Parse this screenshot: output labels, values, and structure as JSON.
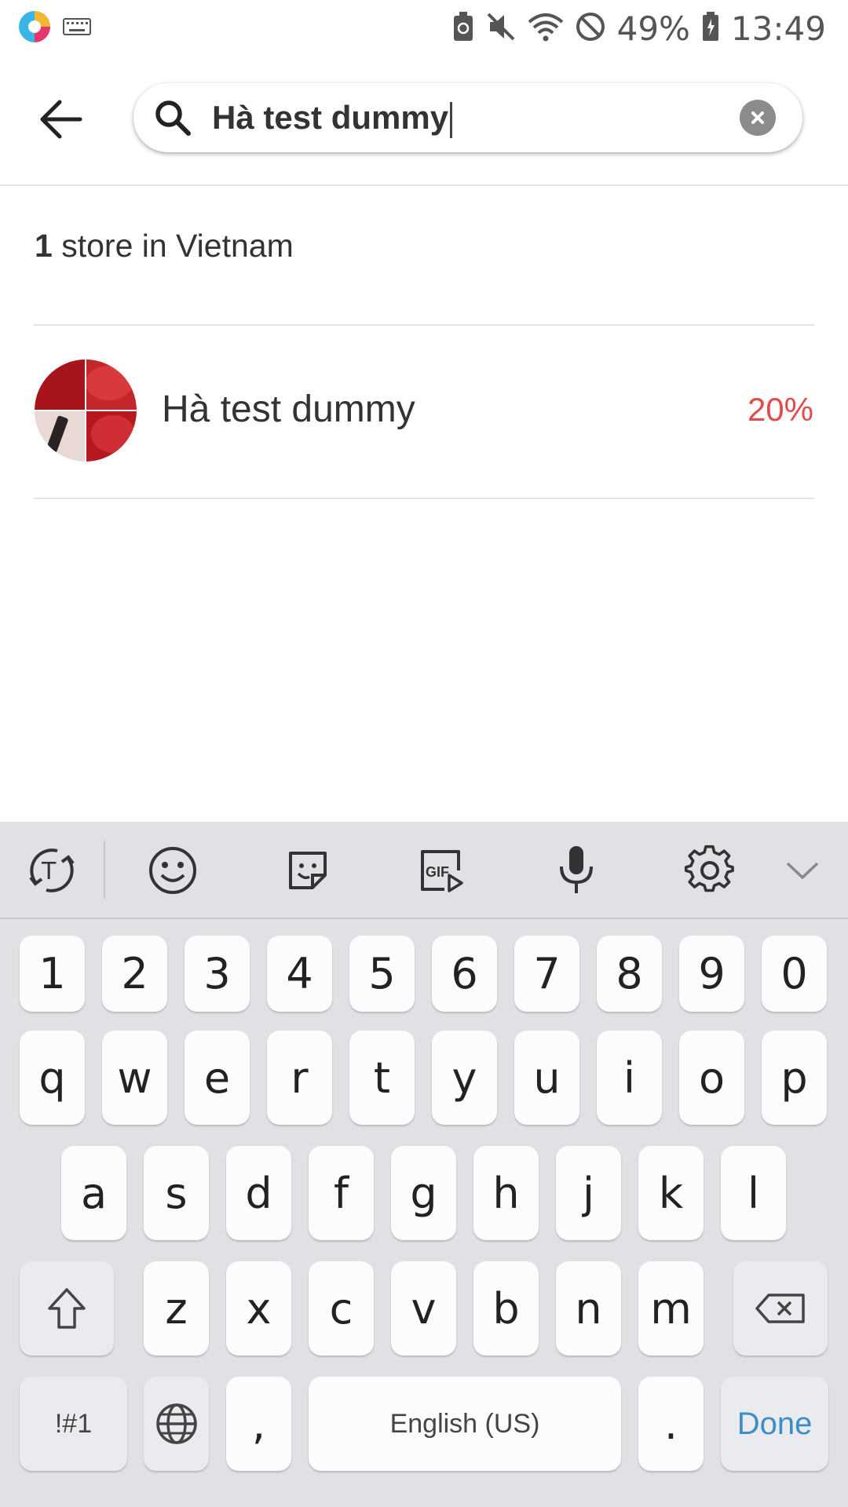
{
  "status_bar": {
    "battery_percent": "49%",
    "time": "13:49",
    "icons": [
      "app-logo-icon",
      "keyboard-icon",
      "battery-saver-icon",
      "mute-icon",
      "wifi-icon",
      "do-not-disturb-icon",
      "battery-icon"
    ]
  },
  "search": {
    "query": "Hà test dummy",
    "icons": [
      "back-arrow-icon",
      "search-icon",
      "clear-icon"
    ]
  },
  "results": {
    "count": "1",
    "label": "store in Vietnam",
    "stores": [
      {
        "name": "Hà test dummy",
        "discount": "20%",
        "avatar_icon": "store-avatar"
      }
    ]
  },
  "colors": {
    "discount": "#e34b4b",
    "done_key": "#3b8fc5",
    "keyboard_bg": "#dfe1e5"
  },
  "keyboard": {
    "toolbar": [
      "text-recognition-icon",
      "emoji-icon",
      "sticker-icon",
      "gif-icon",
      "microphone-icon",
      "settings-icon",
      "collapse-icon"
    ],
    "row_numbers": [
      "1",
      "2",
      "3",
      "4",
      "5",
      "6",
      "7",
      "8",
      "9",
      "0"
    ],
    "row_1": [
      "q",
      "w",
      "e",
      "r",
      "t",
      "y",
      "u",
      "i",
      "o",
      "p"
    ],
    "row_2": [
      "a",
      "s",
      "d",
      "f",
      "g",
      "h",
      "j",
      "k",
      "l"
    ],
    "row_3": [
      "z",
      "x",
      "c",
      "v",
      "b",
      "n",
      "m"
    ],
    "symbols_label": "!#1",
    "comma_label": ",",
    "space_label": "English (US)",
    "period_label": ".",
    "done_label": "Done"
  }
}
